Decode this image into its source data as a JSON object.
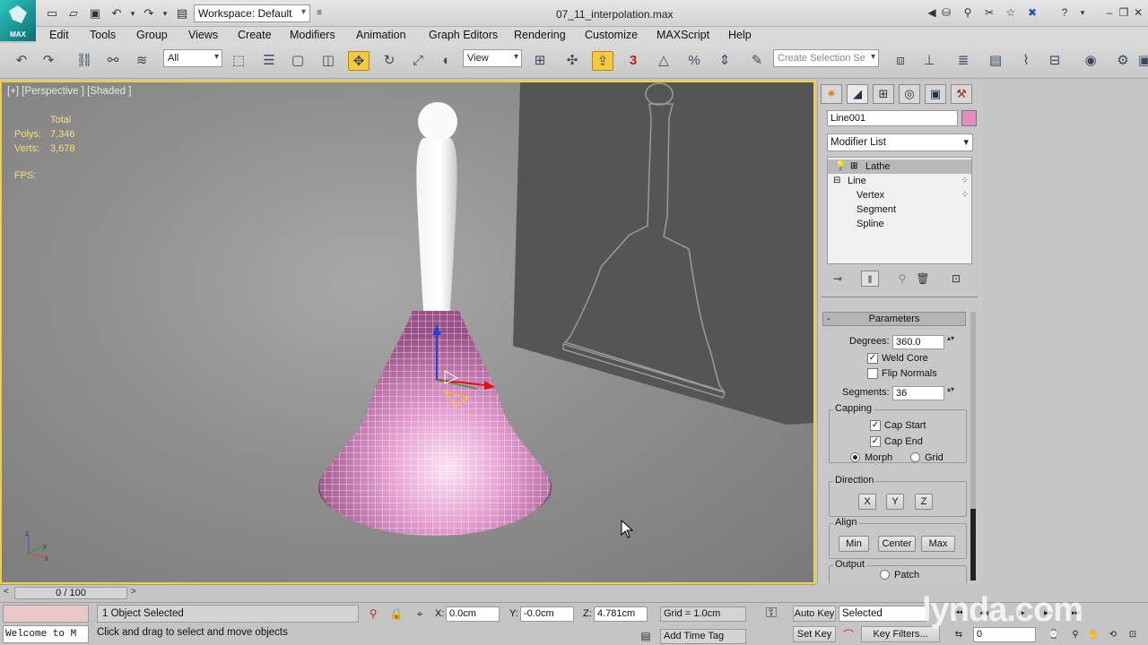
{
  "app": {
    "logo_text": "MAX",
    "workspace": "Workspace: Default",
    "doc_title": "07_11_interpolation.max"
  },
  "menu": [
    "Edit",
    "Tools",
    "Group",
    "Views",
    "Create",
    "Modifiers",
    "Animation",
    "Graph Editors",
    "Rendering",
    "Customize",
    "MAXScript",
    "Help"
  ],
  "toolbar": {
    "selection_filter": "All",
    "ref_coord": "View",
    "snap_3": "3",
    "named_selection_placeholder": "Create Selection Se"
  },
  "viewport": {
    "label": "[+] [Perspective ] [Shaded ]",
    "stats_header": "Total",
    "polys_label": "Polys:",
    "polys_value": "7,346",
    "verts_label": "Verts:",
    "verts_value": "3,678",
    "fps_label": "FPS:",
    "object_color": "#e79ad0",
    "active_border": "#f2d234"
  },
  "command_panel": {
    "object_name": "Line001",
    "object_color": "#e88cc0",
    "modifier_list": "Modifier List",
    "stack": [
      {
        "label": "Lathe",
        "selected": true
      },
      {
        "label": "Line",
        "selected": false
      },
      {
        "label": "Vertex",
        "selected": false
      },
      {
        "label": "Segment",
        "selected": false
      },
      {
        "label": "Spline",
        "selected": false
      }
    ],
    "parameters": {
      "title": "Parameters",
      "degrees_label": "Degrees:",
      "degrees_value": "360.0",
      "weld_core": "Weld Core",
      "weld_core_checked": true,
      "flip_normals": "Flip Normals",
      "flip_normals_checked": false,
      "segments_label": "Segments:",
      "segments_value": "36",
      "capping": "Capping",
      "cap_start": "Cap Start",
      "cap_end": "Cap End",
      "morph": "Morph",
      "grid": "Grid",
      "direction": "Direction",
      "dir_x": "X",
      "dir_y": "Y",
      "dir_z": "Z",
      "align": "Align",
      "align_min": "Min",
      "align_center": "Center",
      "align_max": "Max",
      "output": "Output",
      "patch": "Patch"
    }
  },
  "timeline": {
    "frame_range": "0 / 100"
  },
  "status": {
    "welcome": "Welcome to M",
    "selected": "1 Object Selected",
    "prompt": "Click and drag to select and move objects",
    "x_label": "X:",
    "x_value": "0.0cm",
    "y_label": "Y:",
    "y_value": "-0.0cm",
    "z_label": "Z:",
    "z_value": "4.781cm",
    "grid": "Grid = 1.0cm",
    "add_time_tag": "Add Time Tag",
    "auto_key": "Auto Key",
    "set_key": "Set Key",
    "selected_dropdown": "Selected",
    "key_filters": "Key Filters...",
    "frame": "0"
  },
  "watermark": "lynda.com"
}
